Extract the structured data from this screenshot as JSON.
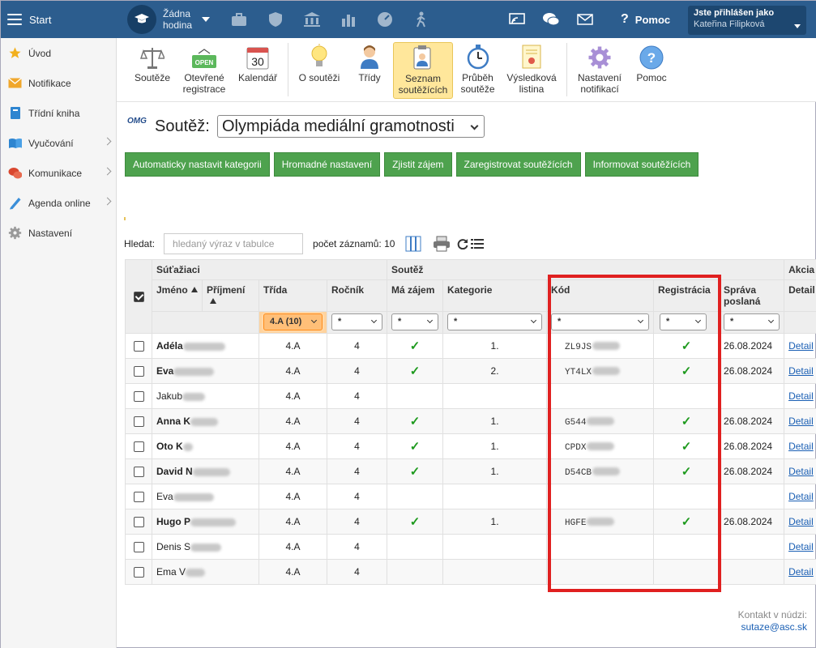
{
  "topbar": {
    "start_label": "Start",
    "hour_line1": "Žádna",
    "hour_line2": "hodina",
    "help_label": "Pomoc",
    "user_line1": "Jste přihlášen jako",
    "user_line2": "Kateřina Filipková"
  },
  "sidebar": {
    "items": [
      {
        "label": "Úvod",
        "icon": "star-icon"
      },
      {
        "label": "Notifikace",
        "icon": "envelope-icon"
      },
      {
        "label": "Třídní kniha",
        "icon": "book-icon"
      },
      {
        "label": "Vyučování",
        "icon": "open-book-icon"
      },
      {
        "label": "Komunikace",
        "icon": "chat-icon"
      },
      {
        "label": "Agenda online",
        "icon": "pencil-icon"
      },
      {
        "label": "Nastavení",
        "icon": "gear-icon"
      }
    ]
  },
  "toolbar": {
    "items": [
      {
        "line1": "Soutěže",
        "line2": "",
        "icon": "scales-icon"
      },
      {
        "line1": "Otevřené",
        "line2": "registrace",
        "icon": "open-sign-icon"
      },
      {
        "line1": "Kalendář",
        "line2": "",
        "icon": "calendar-icon",
        "calendar_day": "30"
      },
      {
        "line1": "O soutěži",
        "line2": "",
        "icon": "lightbulb-icon"
      },
      {
        "line1": "Třídy",
        "line2": "",
        "icon": "person-icon"
      },
      {
        "line1": "Seznam",
        "line2": "soutěžících",
        "icon": "clipboard-icon"
      },
      {
        "line1": "Průběh",
        "line2": "soutěže",
        "icon": "stopwatch-icon"
      },
      {
        "line1": "Výsledková",
        "line2": "listina",
        "icon": "certificate-icon"
      },
      {
        "line1": "Nastavení",
        "line2": "notifikací",
        "icon": "cog-icon"
      },
      {
        "line1": "Pomoc",
        "line2": "",
        "icon": "help-icon"
      }
    ]
  },
  "competition": {
    "logo_text": "OMG",
    "label": "Soutěž:",
    "selected": "Olympiáda mediální gramotnosti"
  },
  "actions": [
    "Automaticky nastavit kategorii",
    "Hromadné nastavení",
    "Zjistit zájem",
    "Zaregistrovat soutěžících",
    "Informovat soutěžících"
  ],
  "search": {
    "label": "Hledat:",
    "placeholder": "hledaný výraz v tabulce",
    "count": "počet záznamů: 10"
  },
  "table": {
    "groups": {
      "students": "Súťažiaci",
      "competition": "Soutěž",
      "action": "Akcia"
    },
    "columns": {
      "first_name": "Jméno",
      "last_name": "Příjmení",
      "class": "Třída",
      "year": "Ročník",
      "interest": "Má zájem",
      "category": "Kategorie",
      "code": "Kód",
      "registration": "Registrácia",
      "message_sent": "Správa poslaná",
      "detail": "Detail"
    },
    "filters": {
      "class": "4.A (10)",
      "interest": "*",
      "category": "*",
      "code": "*",
      "registration": "*",
      "message_sent": "*"
    },
    "rows": [
      {
        "name": "Adéla",
        "bold": true,
        "class": "4.A",
        "year": "4",
        "interest": "✓",
        "category": "1.",
        "code": "ZL9JS",
        "reg": "✓",
        "sent": "26.08.2024",
        "detail": "Detail"
      },
      {
        "name": "Eva",
        "bold": true,
        "class": "4.A",
        "year": "4",
        "interest": "✓",
        "category": "2.",
        "code": "YT4LX",
        "reg": "✓",
        "sent": "26.08.2024",
        "detail": "Detail"
      },
      {
        "name": "Jakub",
        "bold": false,
        "class": "4.A",
        "year": "4",
        "interest": "",
        "category": "",
        "code": "",
        "reg": "",
        "sent": "",
        "detail": "Detail"
      },
      {
        "name": "Anna K",
        "bold": true,
        "class": "4.A",
        "year": "4",
        "interest": "✓",
        "category": "1.",
        "code": "G544",
        "reg": "✓",
        "sent": "26.08.2024",
        "detail": "Detail"
      },
      {
        "name": "Oto K",
        "bold": true,
        "class": "4.A",
        "year": "4",
        "interest": "✓",
        "category": "1.",
        "code": "CPDX",
        "reg": "✓",
        "sent": "26.08.2024",
        "detail": "Detail"
      },
      {
        "name": "David N",
        "bold": true,
        "class": "4.A",
        "year": "4",
        "interest": "✓",
        "category": "1.",
        "code": "D54CB",
        "reg": "✓",
        "sent": "26.08.2024",
        "detail": "Detail"
      },
      {
        "name": "Eva",
        "bold": false,
        "class": "4.A",
        "year": "4",
        "interest": "",
        "category": "",
        "code": "",
        "reg": "",
        "sent": "",
        "detail": "Detail"
      },
      {
        "name": "Hugo P",
        "bold": true,
        "class": "4.A",
        "year": "4",
        "interest": "✓",
        "category": "1.",
        "code": "HGFE",
        "reg": "✓",
        "sent": "26.08.2024",
        "detail": "Detail"
      },
      {
        "name": "Denis S",
        "bold": false,
        "class": "4.A",
        "year": "4",
        "interest": "",
        "category": "",
        "code": "",
        "reg": "",
        "sent": "",
        "detail": "Detail"
      },
      {
        "name": "Ema V",
        "bold": false,
        "class": "4.A",
        "year": "4",
        "interest": "",
        "category": "",
        "code": "",
        "reg": "",
        "sent": "",
        "detail": "Detail"
      }
    ]
  },
  "contact": {
    "label": "Kontakt v núdzi:",
    "email": "sutaze@asc.sk"
  }
}
